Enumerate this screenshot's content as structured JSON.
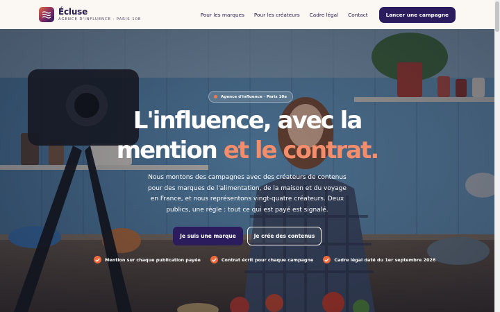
{
  "header": {
    "brand_name": "Écluse",
    "brand_tagline": "AGENCE D'INFLUENCE · PARIS 10E",
    "nav": [
      {
        "label": "Pour les marques"
      },
      {
        "label": "Pour les créateurs"
      },
      {
        "label": "Cadre légal"
      },
      {
        "label": "Contact"
      }
    ],
    "cta_label": "Lancer une campagne"
  },
  "hero": {
    "badge": "Agence d'influence · Paris 10e",
    "title_line1": "L'influence, avec la",
    "title_line2_a": "mention",
    "title_line2_b": " et le contrat.",
    "body": "Nous montons des campagnes avec des créateurs de contenus pour des marques de l'alimentation, de la maison et du voyage en France, et nous représentons vingt-quatre créateurs. Deux publics, une règle : tout ce qui est payé est signalé.",
    "primary_button": "Je suis une marque",
    "secondary_button": "Je crée des contenus",
    "features": [
      {
        "label": "Mention sur chaque publication payée"
      },
      {
        "label": "Contrat écrit pour chaque campagne"
      },
      {
        "label": "Cadre légal daté du 1er septembre 2026"
      }
    ]
  },
  "colors": {
    "brand_dark": "#2b1c5e",
    "accent_orange": "#f48d6b",
    "check_orange": "#ef6a3c",
    "header_bg": "#fbf7f3"
  },
  "icons": {
    "logo": "waves-icon",
    "check": "check-circle-icon"
  }
}
